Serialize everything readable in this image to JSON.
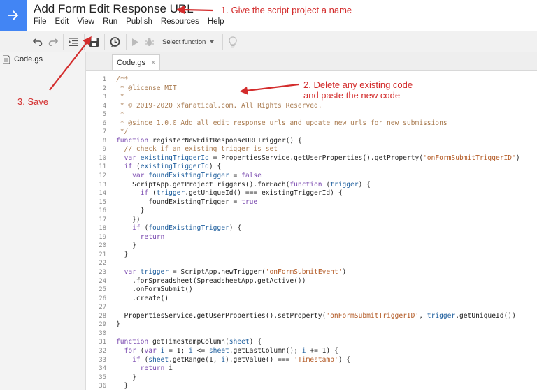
{
  "app": {
    "project_title": "Add Form Edit Response URL",
    "logo_icon": "arrow-right-icon",
    "accent_color": "#4285f4"
  },
  "menu": [
    "File",
    "Edit",
    "View",
    "Run",
    "Publish",
    "Resources",
    "Help"
  ],
  "toolbar": {
    "select_function_label": "Select function",
    "icons": [
      "undo-icon",
      "redo-icon",
      "indent-icon",
      "save-icon",
      "triggers-icon",
      "run-icon",
      "debug-icon",
      "chevron-down-icon",
      "lightbulb-icon"
    ]
  },
  "files": [
    {
      "name": "Code.gs"
    }
  ],
  "editor": {
    "tab_label": "Code.gs",
    "tab_close": "×"
  },
  "code_lines": [
    [
      [
        "c",
        "/**"
      ]
    ],
    [
      [
        "c",
        " * @license MIT"
      ]
    ],
    [
      [
        "c",
        " *"
      ]
    ],
    [
      [
        "c",
        " * © 2019-2020 xfanatical.com. All Rights Reserved."
      ]
    ],
    [
      [
        "c",
        " *"
      ]
    ],
    [
      [
        "c",
        " * @since 1.0.0 Add all edit response urls and update new urls for new submissions"
      ]
    ],
    [
      [
        "c",
        " */"
      ]
    ],
    [
      [
        "k",
        "function"
      ],
      [
        "t",
        " registerNewEditResponseURLTrigger() {"
      ]
    ],
    [
      [
        "c",
        "  // check if an existing trigger is set"
      ]
    ],
    [
      [
        "t",
        "  "
      ],
      [
        "k",
        "var"
      ],
      [
        "t",
        " "
      ],
      [
        "v",
        "existingTriggerId"
      ],
      [
        "t",
        " = PropertiesService.getUserProperties().getProperty("
      ],
      [
        "s",
        "'onFormSubmitTriggerID'"
      ],
      [
        "t",
        ")"
      ]
    ],
    [
      [
        "t",
        "  "
      ],
      [
        "k",
        "if"
      ],
      [
        "t",
        " ("
      ],
      [
        "v",
        "existingTriggerId"
      ],
      [
        "t",
        ") {"
      ]
    ],
    [
      [
        "t",
        "    "
      ],
      [
        "k",
        "var"
      ],
      [
        "t",
        " "
      ],
      [
        "v",
        "foundExistingTrigger"
      ],
      [
        "t",
        " = "
      ],
      [
        "k",
        "false"
      ]
    ],
    [
      [
        "t",
        "    ScriptApp.getProjectTriggers().forEach("
      ],
      [
        "k",
        "function"
      ],
      [
        "t",
        " ("
      ],
      [
        "v",
        "trigger"
      ],
      [
        "t",
        ") {"
      ]
    ],
    [
      [
        "t",
        "      "
      ],
      [
        "k",
        "if"
      ],
      [
        "t",
        " ("
      ],
      [
        "v",
        "trigger"
      ],
      [
        "t",
        ".getUniqueId() === existingTriggerId) {"
      ]
    ],
    [
      [
        "t",
        "        foundExistingTrigger = "
      ],
      [
        "k",
        "true"
      ]
    ],
    [
      [
        "t",
        "      }"
      ]
    ],
    [
      [
        "t",
        "    })"
      ]
    ],
    [
      [
        "t",
        "    "
      ],
      [
        "k",
        "if"
      ],
      [
        "t",
        " ("
      ],
      [
        "v",
        "foundExistingTrigger"
      ],
      [
        "t",
        ") {"
      ]
    ],
    [
      [
        "t",
        "      "
      ],
      [
        "k",
        "return"
      ]
    ],
    [
      [
        "t",
        "    }"
      ]
    ],
    [
      [
        "t",
        "  }"
      ]
    ],
    [
      [
        "t",
        ""
      ]
    ],
    [
      [
        "t",
        "  "
      ],
      [
        "k",
        "var"
      ],
      [
        "t",
        " "
      ],
      [
        "v",
        "trigger"
      ],
      [
        "t",
        " = ScriptApp.newTrigger("
      ],
      [
        "s",
        "'onFormSubmitEvent'"
      ],
      [
        "t",
        ")"
      ]
    ],
    [
      [
        "t",
        "    .forSpreadsheet(SpreadsheetApp.getActive())"
      ]
    ],
    [
      [
        "t",
        "    .onFormSubmit()"
      ]
    ],
    [
      [
        "t",
        "    .create()"
      ]
    ],
    [
      [
        "t",
        ""
      ]
    ],
    [
      [
        "t",
        "  PropertiesService.getUserProperties().setProperty("
      ],
      [
        "s",
        "'onFormSubmitTriggerID'"
      ],
      [
        "t",
        ", "
      ],
      [
        "v",
        "trigger"
      ],
      [
        "t",
        ".getUniqueId())"
      ]
    ],
    [
      [
        "t",
        "}"
      ]
    ],
    [
      [
        "t",
        ""
      ]
    ],
    [
      [
        "k",
        "function"
      ],
      [
        "t",
        " getTimestampColumn("
      ],
      [
        "v",
        "sheet"
      ],
      [
        "t",
        ") {"
      ]
    ],
    [
      [
        "t",
        "  "
      ],
      [
        "k",
        "for"
      ],
      [
        "t",
        " ("
      ],
      [
        "k",
        "var"
      ],
      [
        "t",
        " "
      ],
      [
        "v",
        "i"
      ],
      [
        "t",
        " = 1; "
      ],
      [
        "v",
        "i"
      ],
      [
        "t",
        " <= "
      ],
      [
        "v",
        "sheet"
      ],
      [
        "t",
        ".getLastColumn(); "
      ],
      [
        "v",
        "i"
      ],
      [
        "t",
        " += 1) {"
      ]
    ],
    [
      [
        "t",
        "    "
      ],
      [
        "k",
        "if"
      ],
      [
        "t",
        " ("
      ],
      [
        "v",
        "sheet"
      ],
      [
        "t",
        ".getRange(1, "
      ],
      [
        "v",
        "i"
      ],
      [
        "t",
        ").getValue() === "
      ],
      [
        "s",
        "'Timestamp'"
      ],
      [
        "t",
        ") {"
      ]
    ],
    [
      [
        "t",
        "      "
      ],
      [
        "k",
        "return"
      ],
      [
        "t",
        " i"
      ]
    ],
    [
      [
        "t",
        "    }"
      ]
    ],
    [
      [
        "t",
        "  }"
      ]
    ]
  ],
  "annotations": {
    "note1": "1. Give the script project a name",
    "note2_line1": "2. Delete any existing code",
    "note2_line2": "and paste the new code",
    "note3": "3. Save",
    "color": "#d32c2c"
  }
}
